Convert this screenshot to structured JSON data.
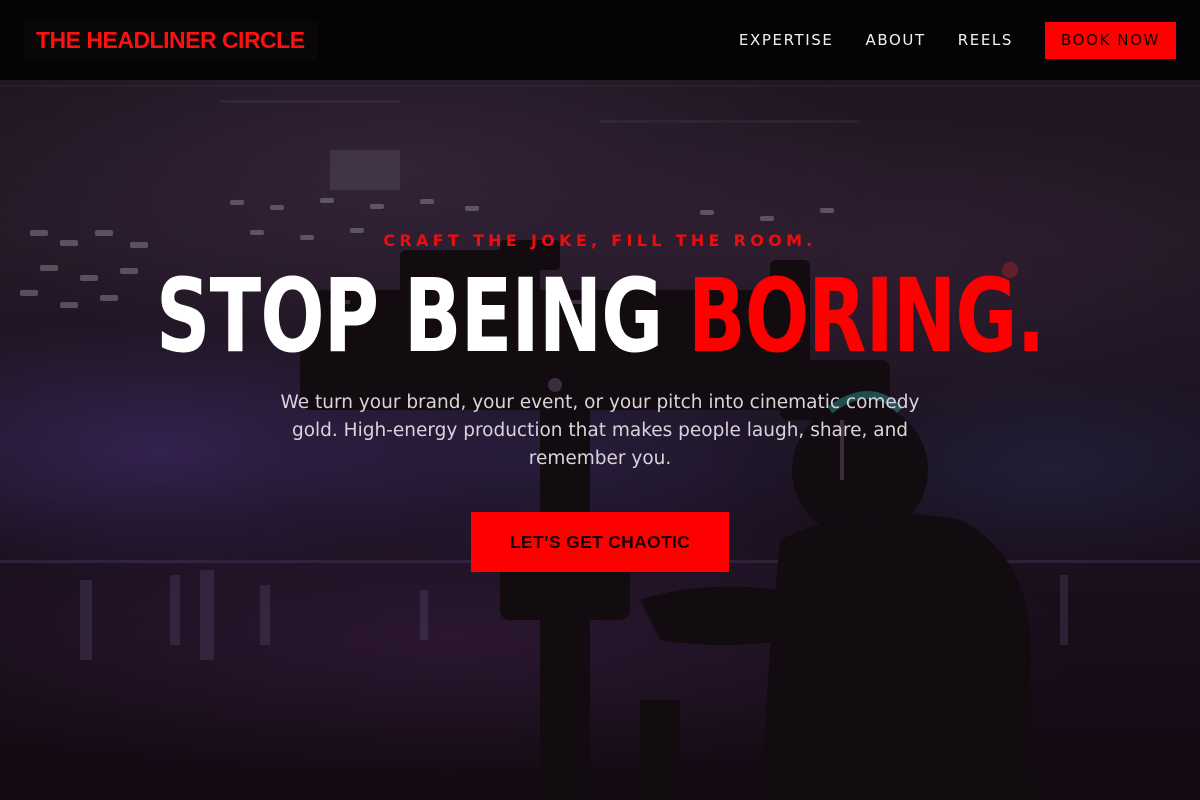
{
  "nav": {
    "brand": "THE HEADLINER CIRCLE",
    "links": [
      {
        "label": "EXPERTISE"
      },
      {
        "label": "ABOUT"
      },
      {
        "label": "REELS"
      }
    ],
    "cta_label": "BOOK NOW"
  },
  "hero": {
    "kicker": "CRAFT THE JOKE, FILL THE ROOM.",
    "headline_white": "STOP BEING ",
    "headline_red": "BORING.",
    "subtitle": "We turn your brand, your event, or your pitch into cinematic comedy gold. High-energy production that makes people laugh, share, and remember you.",
    "cta_label": "LET’S GET CHAOTIC"
  },
  "colors": {
    "accent": "#ff0000",
    "nav_background": "#050305",
    "text_light": "#f2f2f2"
  }
}
